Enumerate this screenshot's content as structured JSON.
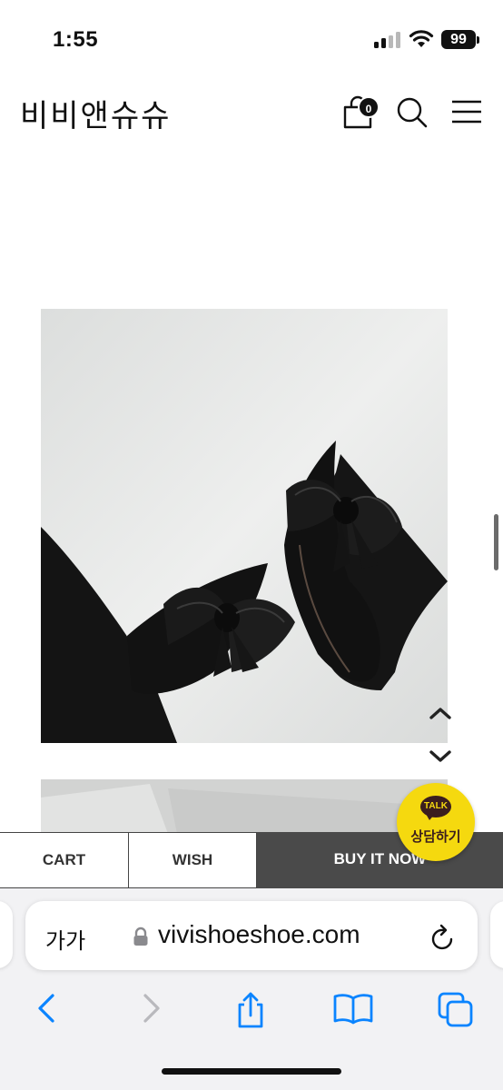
{
  "status_bar": {
    "time": "1:55",
    "battery": "99",
    "icons": [
      "cellular-signal-icon",
      "wifi-icon",
      "battery-icon"
    ]
  },
  "header": {
    "logo": "비비앤슈슈",
    "cart_count": "0",
    "icons": [
      "shopping-bag-icon",
      "search-icon",
      "hamburger-menu-icon"
    ]
  },
  "gallery": {
    "icons": [
      "chevron-up-icon",
      "chevron-down-icon"
    ]
  },
  "kakao": {
    "bubble_text": "TALK",
    "label": "상담하기",
    "color": "#f5d90f"
  },
  "actions": {
    "cart_label": "CART",
    "wish_label": "WISH",
    "buy_label": "BUY IT NOW",
    "buy_bg": "#4a4a4a"
  },
  "browser": {
    "aa_label": "가가",
    "url": "vivishoeshoe.com",
    "icons": [
      "lock-icon",
      "reload-icon",
      "back-icon",
      "forward-icon",
      "share-icon",
      "bookmarks-icon",
      "tabs-icon"
    ],
    "accent": "#0a84ff"
  }
}
